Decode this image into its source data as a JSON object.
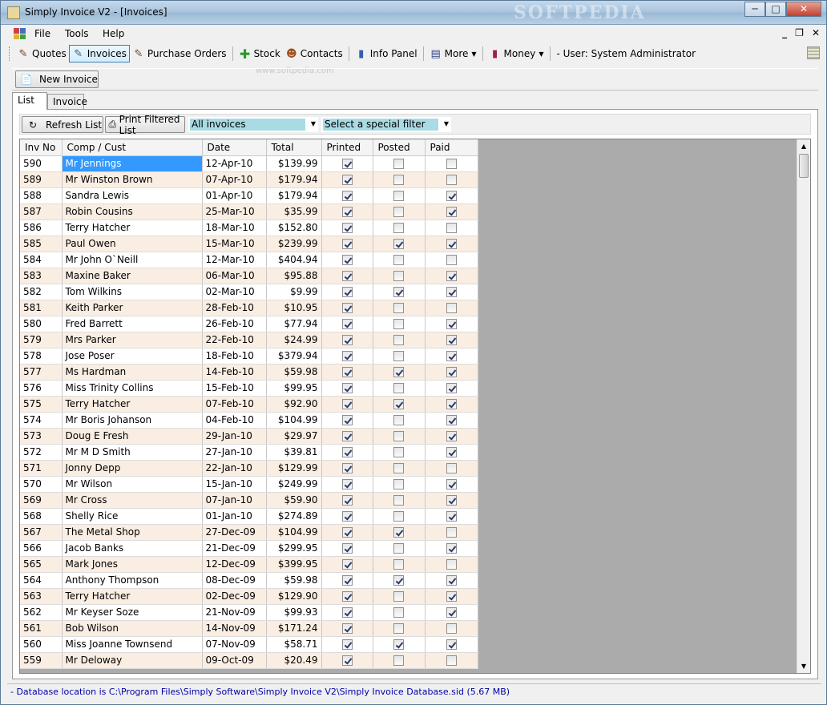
{
  "window": {
    "title": "Simply Invoice V2 - [Invoices]",
    "watermark": "SOFTPEDIA",
    "watermark_small": "www.softpedia.com",
    "minimize": "─",
    "maximize": "□",
    "close": "✕"
  },
  "menu": {
    "items": [
      "File",
      "Tools",
      "Help"
    ],
    "mdi_minimize": "_",
    "mdi_restore": "❐",
    "mdi_close": "✕"
  },
  "toolbar": {
    "quotes": "Quotes",
    "invoices": "Invoices",
    "purchase_orders": "Purchase Orders",
    "stock": "Stock",
    "contacts": "Contacts",
    "info_panel": "Info Panel",
    "more": "More",
    "money": "Money",
    "user": "- User: System Administrator",
    "icons": [
      "quotes-icon",
      "invoices-icon",
      "purchase-orders-icon",
      "stock-icon",
      "contacts-icon",
      "info-panel-icon",
      "more-icon",
      "money-icon"
    ]
  },
  "top": {
    "new_invoice": "New Invoice"
  },
  "tabs": {
    "list": "List",
    "invoice": "Invoice"
  },
  "filter": {
    "refresh": "Refresh List",
    "print": "Print Filtered List",
    "status_value": "All invoices",
    "special_value": "Select a special filter"
  },
  "table": {
    "columns": [
      "Inv No",
      "Comp / Cust",
      "Date",
      "Total",
      "Printed",
      "Posted",
      "Paid"
    ],
    "rows": [
      {
        "no": "590",
        "cust": "Mr Jennings",
        "date": "12-Apr-10",
        "total": "$139.99",
        "printed": true,
        "posted": false,
        "paid": false
      },
      {
        "no": "589",
        "cust": "Mr Winston Brown",
        "date": "07-Apr-10",
        "total": "$179.94",
        "printed": true,
        "posted": false,
        "paid": false
      },
      {
        "no": "588",
        "cust": "Sandra Lewis",
        "date": "01-Apr-10",
        "total": "$179.94",
        "printed": true,
        "posted": false,
        "paid": true
      },
      {
        "no": "587",
        "cust": "Robin Cousins",
        "date": "25-Mar-10",
        "total": "$35.99",
        "printed": true,
        "posted": false,
        "paid": true
      },
      {
        "no": "586",
        "cust": "Terry Hatcher",
        "date": "18-Mar-10",
        "total": "$152.80",
        "printed": true,
        "posted": false,
        "paid": false
      },
      {
        "no": "585",
        "cust": "Paul Owen",
        "date": "15-Mar-10",
        "total": "$239.99",
        "printed": true,
        "posted": true,
        "paid": true
      },
      {
        "no": "584",
        "cust": "Mr John O`Neill",
        "date": "12-Mar-10",
        "total": "$404.94",
        "printed": true,
        "posted": false,
        "paid": false
      },
      {
        "no": "583",
        "cust": "Maxine Baker",
        "date": "06-Mar-10",
        "total": "$95.88",
        "printed": true,
        "posted": false,
        "paid": true
      },
      {
        "no": "582",
        "cust": "Tom Wilkins",
        "date": "02-Mar-10",
        "total": "$9.99",
        "printed": true,
        "posted": true,
        "paid": true
      },
      {
        "no": "581",
        "cust": "Keith Parker",
        "date": "28-Feb-10",
        "total": "$10.95",
        "printed": true,
        "posted": false,
        "paid": false
      },
      {
        "no": "580",
        "cust": "Fred Barrett",
        "date": "26-Feb-10",
        "total": "$77.94",
        "printed": true,
        "posted": false,
        "paid": true
      },
      {
        "no": "579",
        "cust": "Mrs Parker",
        "date": "22-Feb-10",
        "total": "$24.99",
        "printed": true,
        "posted": false,
        "paid": true
      },
      {
        "no": "578",
        "cust": "Jose Poser",
        "date": "18-Feb-10",
        "total": "$379.94",
        "printed": true,
        "posted": false,
        "paid": true
      },
      {
        "no": "577",
        "cust": "Ms Hardman",
        "date": "14-Feb-10",
        "total": "$59.98",
        "printed": true,
        "posted": true,
        "paid": true
      },
      {
        "no": "576",
        "cust": "Miss Trinity Collins",
        "date": "15-Feb-10",
        "total": "$99.95",
        "printed": true,
        "posted": false,
        "paid": true
      },
      {
        "no": "575",
        "cust": "Terry Hatcher",
        "date": "07-Feb-10",
        "total": "$92.90",
        "printed": true,
        "posted": true,
        "paid": true
      },
      {
        "no": "574",
        "cust": "Mr Boris Johanson",
        "date": "04-Feb-10",
        "total": "$104.99",
        "printed": true,
        "posted": false,
        "paid": true
      },
      {
        "no": "573",
        "cust": "Doug E Fresh",
        "date": "29-Jan-10",
        "total": "$29.97",
        "printed": true,
        "posted": false,
        "paid": true
      },
      {
        "no": "572",
        "cust": "Mr M D Smith",
        "date": "27-Jan-10",
        "total": "$39.81",
        "printed": true,
        "posted": false,
        "paid": true
      },
      {
        "no": "571",
        "cust": "Jonny Depp",
        "date": "22-Jan-10",
        "total": "$129.99",
        "printed": true,
        "posted": false,
        "paid": false
      },
      {
        "no": "570",
        "cust": "Mr Wilson",
        "date": "15-Jan-10",
        "total": "$249.99",
        "printed": true,
        "posted": false,
        "paid": true
      },
      {
        "no": "569",
        "cust": "Mr Cross",
        "date": "07-Jan-10",
        "total": "$59.90",
        "printed": true,
        "posted": false,
        "paid": true
      },
      {
        "no": "568",
        "cust": "Shelly Rice",
        "date": "01-Jan-10",
        "total": "$274.89",
        "printed": true,
        "posted": false,
        "paid": true
      },
      {
        "no": "567",
        "cust": "The Metal Shop",
        "date": "27-Dec-09",
        "total": "$104.99",
        "printed": true,
        "posted": true,
        "paid": false
      },
      {
        "no": "566",
        "cust": "Jacob Banks",
        "date": "21-Dec-09",
        "total": "$299.95",
        "printed": true,
        "posted": false,
        "paid": true
      },
      {
        "no": "565",
        "cust": "Mark Jones",
        "date": "12-Dec-09",
        "total": "$399.95",
        "printed": true,
        "posted": false,
        "paid": false
      },
      {
        "no": "564",
        "cust": "Anthony Thompson",
        "date": "08-Dec-09",
        "total": "$59.98",
        "printed": true,
        "posted": true,
        "paid": true
      },
      {
        "no": "563",
        "cust": "Terry Hatcher",
        "date": "02-Dec-09",
        "total": "$129.90",
        "printed": true,
        "posted": false,
        "paid": true
      },
      {
        "no": "562",
        "cust": "Mr Keyser Soze",
        "date": "21-Nov-09",
        "total": "$99.93",
        "printed": true,
        "posted": false,
        "paid": true
      },
      {
        "no": "561",
        "cust": "Bob Wilson",
        "date": "14-Nov-09",
        "total": "$171.24",
        "printed": true,
        "posted": false,
        "paid": false
      },
      {
        "no": "560",
        "cust": "Miss Joanne Townsend",
        "date": "07-Nov-09",
        "total": "$58.71",
        "printed": true,
        "posted": true,
        "paid": true
      },
      {
        "no": "559",
        "cust": "Mr Deloway",
        "date": "09-Oct-09",
        "total": "$20.49",
        "printed": true,
        "posted": false,
        "paid": false
      }
    ]
  },
  "status": {
    "text": "- Database location is C:\\Program Files\\Simply Software\\Simply Invoice V2\\Simply Invoice Database.sid (5.67 MB)"
  },
  "colors": {
    "selection": "#3399ff",
    "alt_row": "#faeee2",
    "combo_highlight": "#a8dbe4",
    "status_text": "#0000aa"
  }
}
